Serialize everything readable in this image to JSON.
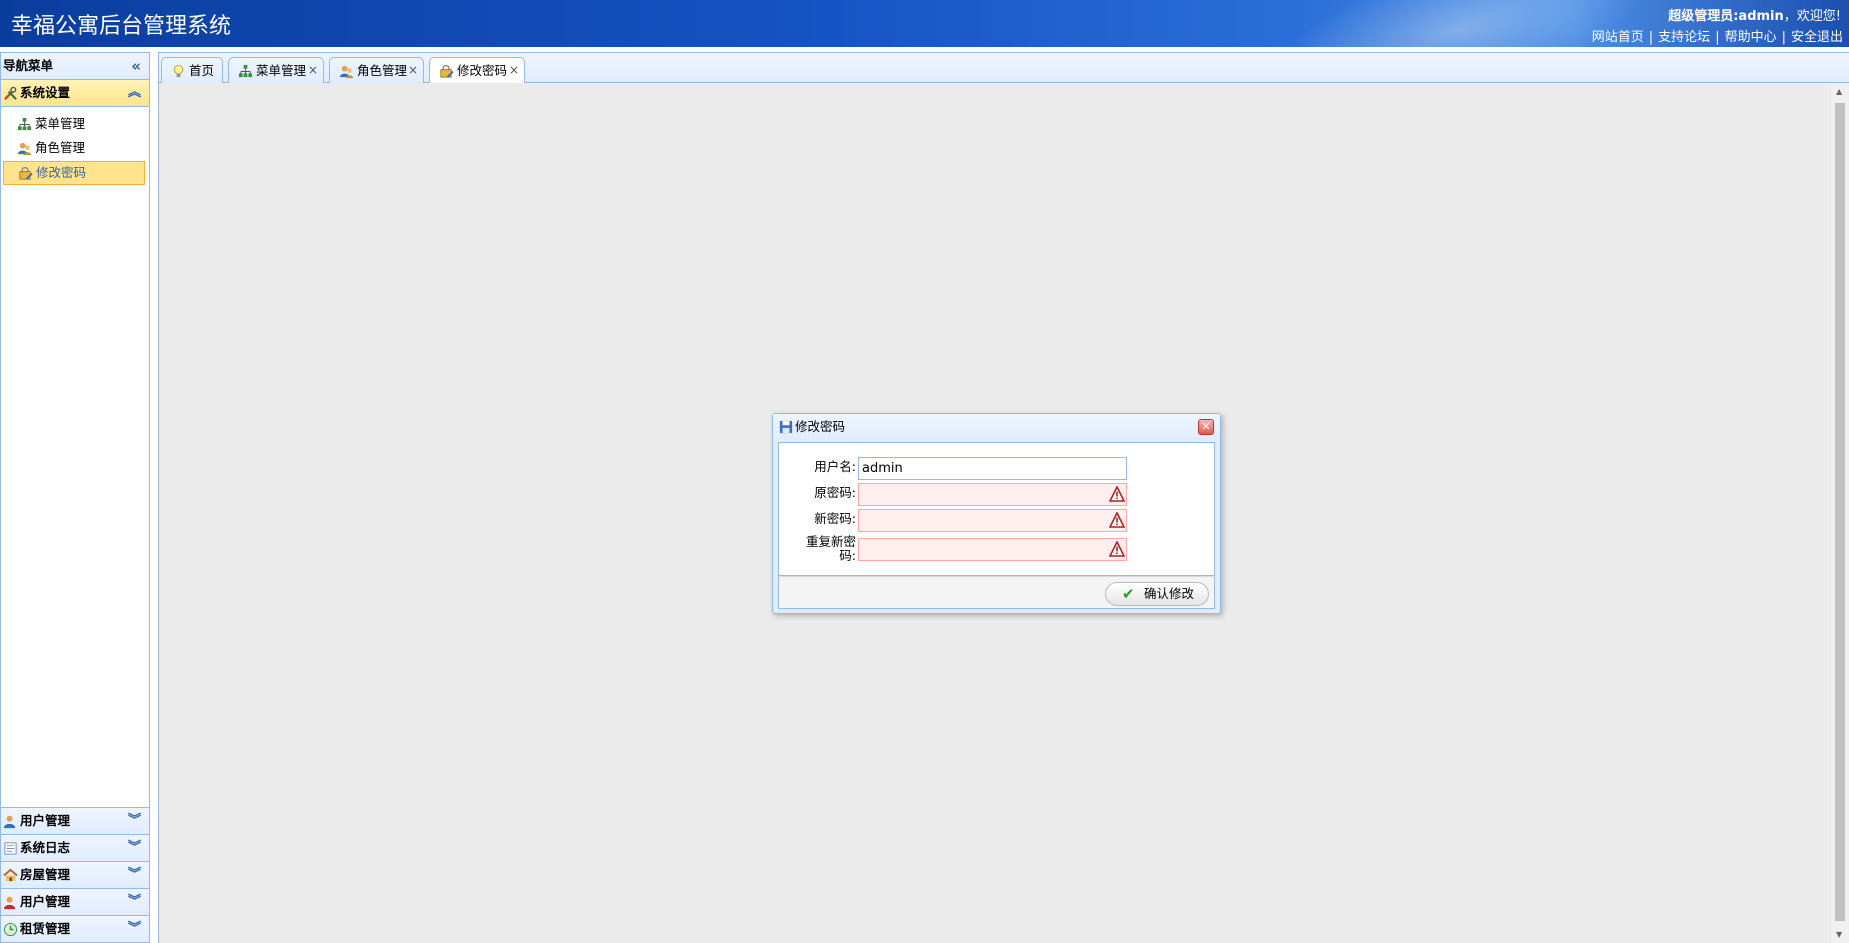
{
  "header": {
    "title": "幸福公寓后台管理系统",
    "welcome_user": "超级管理员:admin",
    "welcome_suffix": "，欢迎您!",
    "links": [
      "网站首页",
      "支持论坛",
      "帮助中心",
      "安全退出"
    ]
  },
  "sidebar": {
    "nav_title": "导航菜单",
    "active_group": "系统设置",
    "items": [
      {
        "label": "菜单管理",
        "icon": "sitemap-icon"
      },
      {
        "label": "角色管理",
        "icon": "users-icon"
      },
      {
        "label": "修改密码",
        "icon": "lock-edit-icon"
      }
    ],
    "groups": [
      {
        "label": "用户管理",
        "icon": "user-icon"
      },
      {
        "label": "系统日志",
        "icon": "log-icon"
      },
      {
        "label": "房屋管理",
        "icon": "house-icon"
      },
      {
        "label": "用户管理",
        "icon": "user-icon"
      },
      {
        "label": "租赁管理",
        "icon": "clock-icon"
      }
    ]
  },
  "tabs": [
    {
      "label": "首页",
      "icon": "lightbulb-icon"
    },
    {
      "label": "菜单管理",
      "icon": "sitemap-icon"
    },
    {
      "label": "角色管理",
      "icon": "users-icon"
    },
    {
      "label": "修改密码",
      "icon": "lock-edit-icon"
    }
  ],
  "dialog": {
    "title": "修改密码",
    "fields": {
      "username_label": "用户名:",
      "username_value": "admin",
      "old_password_label": "原密码:",
      "new_password_label": "新密码:",
      "repeat_password_label_1": "重复新密",
      "repeat_password_label_2": "码:"
    },
    "submit_label": "确认修改"
  },
  "colors": {
    "header_blue": "#1554c4",
    "border_blue": "#95b8e7",
    "highlight_yellow": "#ffe48d",
    "invalid_pink": "#ffeeee"
  }
}
